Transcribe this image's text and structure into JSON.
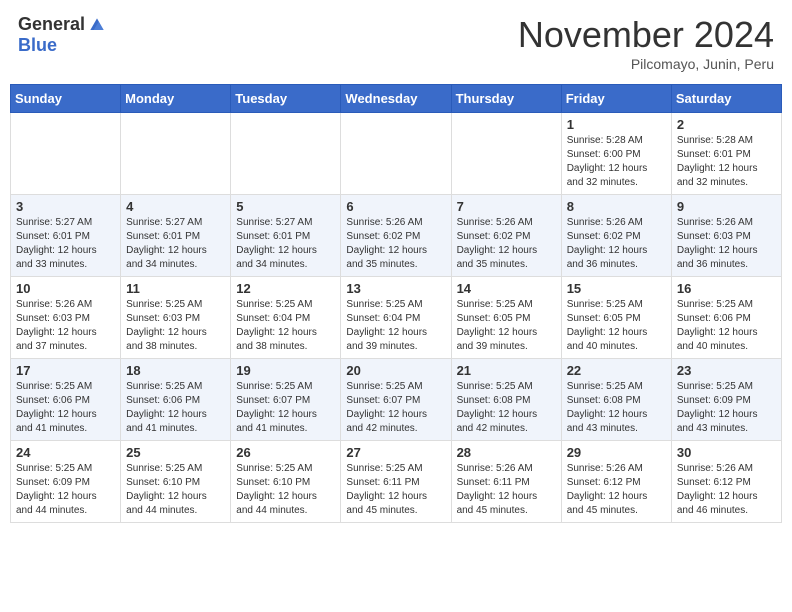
{
  "header": {
    "logo_general": "General",
    "logo_blue": "Blue",
    "month_title": "November 2024",
    "subtitle": "Pilcomayo, Junin, Peru"
  },
  "calendar": {
    "days_of_week": [
      "Sunday",
      "Monday",
      "Tuesday",
      "Wednesday",
      "Thursday",
      "Friday",
      "Saturday"
    ],
    "weeks": [
      [
        {
          "day": "",
          "info": ""
        },
        {
          "day": "",
          "info": ""
        },
        {
          "day": "",
          "info": ""
        },
        {
          "day": "",
          "info": ""
        },
        {
          "day": "",
          "info": ""
        },
        {
          "day": "1",
          "info": "Sunrise: 5:28 AM\nSunset: 6:00 PM\nDaylight: 12 hours and 32 minutes."
        },
        {
          "day": "2",
          "info": "Sunrise: 5:28 AM\nSunset: 6:01 PM\nDaylight: 12 hours and 32 minutes."
        }
      ],
      [
        {
          "day": "3",
          "info": "Sunrise: 5:27 AM\nSunset: 6:01 PM\nDaylight: 12 hours and 33 minutes."
        },
        {
          "day": "4",
          "info": "Sunrise: 5:27 AM\nSunset: 6:01 PM\nDaylight: 12 hours and 34 minutes."
        },
        {
          "day": "5",
          "info": "Sunrise: 5:27 AM\nSunset: 6:01 PM\nDaylight: 12 hours and 34 minutes."
        },
        {
          "day": "6",
          "info": "Sunrise: 5:26 AM\nSunset: 6:02 PM\nDaylight: 12 hours and 35 minutes."
        },
        {
          "day": "7",
          "info": "Sunrise: 5:26 AM\nSunset: 6:02 PM\nDaylight: 12 hours and 35 minutes."
        },
        {
          "day": "8",
          "info": "Sunrise: 5:26 AM\nSunset: 6:02 PM\nDaylight: 12 hours and 36 minutes."
        },
        {
          "day": "9",
          "info": "Sunrise: 5:26 AM\nSunset: 6:03 PM\nDaylight: 12 hours and 36 minutes."
        }
      ],
      [
        {
          "day": "10",
          "info": "Sunrise: 5:26 AM\nSunset: 6:03 PM\nDaylight: 12 hours and 37 minutes."
        },
        {
          "day": "11",
          "info": "Sunrise: 5:25 AM\nSunset: 6:03 PM\nDaylight: 12 hours and 38 minutes."
        },
        {
          "day": "12",
          "info": "Sunrise: 5:25 AM\nSunset: 6:04 PM\nDaylight: 12 hours and 38 minutes."
        },
        {
          "day": "13",
          "info": "Sunrise: 5:25 AM\nSunset: 6:04 PM\nDaylight: 12 hours and 39 minutes."
        },
        {
          "day": "14",
          "info": "Sunrise: 5:25 AM\nSunset: 6:05 PM\nDaylight: 12 hours and 39 minutes."
        },
        {
          "day": "15",
          "info": "Sunrise: 5:25 AM\nSunset: 6:05 PM\nDaylight: 12 hours and 40 minutes."
        },
        {
          "day": "16",
          "info": "Sunrise: 5:25 AM\nSunset: 6:06 PM\nDaylight: 12 hours and 40 minutes."
        }
      ],
      [
        {
          "day": "17",
          "info": "Sunrise: 5:25 AM\nSunset: 6:06 PM\nDaylight: 12 hours and 41 minutes."
        },
        {
          "day": "18",
          "info": "Sunrise: 5:25 AM\nSunset: 6:06 PM\nDaylight: 12 hours and 41 minutes."
        },
        {
          "day": "19",
          "info": "Sunrise: 5:25 AM\nSunset: 6:07 PM\nDaylight: 12 hours and 41 minutes."
        },
        {
          "day": "20",
          "info": "Sunrise: 5:25 AM\nSunset: 6:07 PM\nDaylight: 12 hours and 42 minutes."
        },
        {
          "day": "21",
          "info": "Sunrise: 5:25 AM\nSunset: 6:08 PM\nDaylight: 12 hours and 42 minutes."
        },
        {
          "day": "22",
          "info": "Sunrise: 5:25 AM\nSunset: 6:08 PM\nDaylight: 12 hours and 43 minutes."
        },
        {
          "day": "23",
          "info": "Sunrise: 5:25 AM\nSunset: 6:09 PM\nDaylight: 12 hours and 43 minutes."
        }
      ],
      [
        {
          "day": "24",
          "info": "Sunrise: 5:25 AM\nSunset: 6:09 PM\nDaylight: 12 hours and 44 minutes."
        },
        {
          "day": "25",
          "info": "Sunrise: 5:25 AM\nSunset: 6:10 PM\nDaylight: 12 hours and 44 minutes."
        },
        {
          "day": "26",
          "info": "Sunrise: 5:25 AM\nSunset: 6:10 PM\nDaylight: 12 hours and 44 minutes."
        },
        {
          "day": "27",
          "info": "Sunrise: 5:25 AM\nSunset: 6:11 PM\nDaylight: 12 hours and 45 minutes."
        },
        {
          "day": "28",
          "info": "Sunrise: 5:26 AM\nSunset: 6:11 PM\nDaylight: 12 hours and 45 minutes."
        },
        {
          "day": "29",
          "info": "Sunrise: 5:26 AM\nSunset: 6:12 PM\nDaylight: 12 hours and 45 minutes."
        },
        {
          "day": "30",
          "info": "Sunrise: 5:26 AM\nSunset: 6:12 PM\nDaylight: 12 hours and 46 minutes."
        }
      ]
    ]
  }
}
